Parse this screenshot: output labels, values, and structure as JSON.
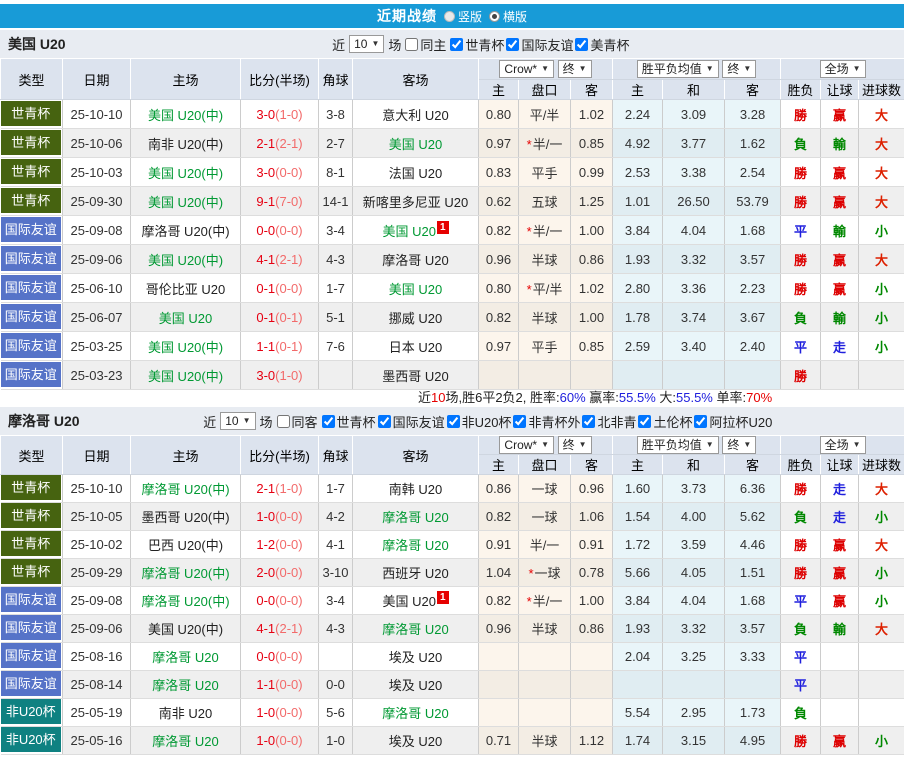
{
  "topbar": {
    "title": "近期战绩",
    "radio_vertical": "竖版",
    "radio_horizontal": "横版",
    "bg": "#189bd7"
  },
  "columns": {
    "type": "类型",
    "date": "日期",
    "home": "主场",
    "score": "比分(半场)",
    "corner": "角球",
    "away": "客场",
    "dd_company": "Crow*",
    "dd_final": "终",
    "dd_avg": "胜平负均值",
    "dd_final2": "终",
    "dd_scope": "全场",
    "sub_home": "主",
    "sub_handicap": "盘口",
    "sub_away": "客",
    "sub_home2": "主",
    "sub_draw": "和",
    "sub_away2": "客",
    "sub_result": "胜负",
    "sub_let": "让球",
    "sub_goals": "进球数"
  },
  "type_colors": {
    "世青杯": "#466310",
    "国际友谊": "#5673c8",
    "非U20杯": "#0f8181"
  },
  "result_color_map": {
    "勝": "#dd0000",
    "負": "#008800",
    "平": "#2020dd",
    "赢": "#dd0000",
    "輸": "#008800",
    "走": "#2020dd",
    "大": "#dd2000",
    "小": "#008800"
  },
  "tables": [
    {
      "team": "美国 U20",
      "filter": {
        "near_label": "近",
        "count": "10",
        "games_label": "场",
        "same_label": "同主",
        "same_checked": false,
        "leagues": [
          "世青杯",
          "国际友谊",
          "美青杯"
        ]
      },
      "rows": [
        {
          "type": "世青杯",
          "date": "25-10-10",
          "home": "美国 U20(中)",
          "home_green": true,
          "score": "3-0",
          "half": "(1-0)",
          "corner": "3-8",
          "away": "意大利 U20",
          "away_green": false,
          "badge": "",
          "odds_home": "0.80",
          "handicap": "平/半",
          "handicap_star": false,
          "odds_away": "1.02",
          "avg_home": "2.24",
          "avg_draw": "3.09",
          "avg_away": "3.28",
          "result": "勝",
          "handicap_result": "赢",
          "goals": "大"
        },
        {
          "type": "世青杯",
          "date": "25-10-06",
          "home": "南非 U20(中)",
          "home_green": false,
          "score": "2-1",
          "half": "(2-1)",
          "corner": "2-7",
          "away": "美国 U20",
          "away_green": true,
          "badge": "",
          "odds_home": "0.97",
          "handicap": "半/一",
          "handicap_star": true,
          "odds_away": "0.85",
          "avg_home": "4.92",
          "avg_draw": "3.77",
          "avg_away": "1.62",
          "result": "負",
          "handicap_result": "輸",
          "goals": "大"
        },
        {
          "type": "世青杯",
          "date": "25-10-03",
          "home": "美国 U20(中)",
          "home_green": true,
          "score": "3-0",
          "half": "(0-0)",
          "corner": "8-1",
          "away": "法国 U20",
          "away_green": false,
          "badge": "",
          "odds_home": "0.83",
          "handicap": "平手",
          "handicap_star": false,
          "odds_away": "0.99",
          "avg_home": "2.53",
          "avg_draw": "3.38",
          "avg_away": "2.54",
          "result": "勝",
          "handicap_result": "赢",
          "goals": "大"
        },
        {
          "type": "世青杯",
          "date": "25-09-30",
          "home": "美国 U20(中)",
          "home_green": true,
          "score": "9-1",
          "half": "(7-0)",
          "corner": "14-1",
          "away": "新喀里多尼亚 U20",
          "away_green": false,
          "badge": "",
          "odds_home": "0.62",
          "handicap": "五球",
          "handicap_star": false,
          "odds_away": "1.25",
          "avg_home": "1.01",
          "avg_draw": "26.50",
          "avg_away": "53.79",
          "result": "勝",
          "handicap_result": "赢",
          "goals": "大"
        },
        {
          "type": "国际友谊",
          "date": "25-09-08",
          "home": "摩洛哥 U20(中)",
          "home_green": false,
          "score": "0-0",
          "half": "(0-0)",
          "corner": "3-4",
          "away": "美国 U20",
          "away_green": true,
          "badge": "1",
          "odds_home": "0.82",
          "handicap": "半/一",
          "handicap_star": true,
          "odds_away": "1.00",
          "avg_home": "3.84",
          "avg_draw": "4.04",
          "avg_away": "1.68",
          "result": "平",
          "handicap_result": "輸",
          "goals": "小"
        },
        {
          "type": "国际友谊",
          "date": "25-09-06",
          "home": "美国 U20(中)",
          "home_green": true,
          "score": "4-1",
          "half": "(2-1)",
          "corner": "4-3",
          "away": "摩洛哥 U20",
          "away_green": false,
          "badge": "",
          "odds_home": "0.96",
          "handicap": "半球",
          "handicap_star": false,
          "odds_away": "0.86",
          "avg_home": "1.93",
          "avg_draw": "3.32",
          "avg_away": "3.57",
          "result": "勝",
          "handicap_result": "赢",
          "goals": "大"
        },
        {
          "type": "国际友谊",
          "date": "25-06-10",
          "home": "哥伦比亚 U20",
          "home_green": false,
          "score": "0-1",
          "half": "(0-0)",
          "corner": "1-7",
          "away": "美国 U20",
          "away_green": true,
          "badge": "",
          "odds_home": "0.80",
          "handicap": "平/半",
          "handicap_star": true,
          "odds_away": "1.02",
          "avg_home": "2.80",
          "avg_draw": "3.36",
          "avg_away": "2.23",
          "result": "勝",
          "handicap_result": "赢",
          "goals": "小"
        },
        {
          "type": "国际友谊",
          "date": "25-06-07",
          "home": "美国 U20",
          "home_green": true,
          "score": "0-1",
          "half": "(0-1)",
          "corner": "5-1",
          "away": "挪威 U20",
          "away_green": false,
          "badge": "",
          "odds_home": "0.82",
          "handicap": "半球",
          "handicap_star": false,
          "odds_away": "1.00",
          "avg_home": "1.78",
          "avg_draw": "3.74",
          "avg_away": "3.67",
          "result": "負",
          "handicap_result": "輸",
          "goals": "小"
        },
        {
          "type": "国际友谊",
          "date": "25-03-25",
          "home": "美国 U20(中)",
          "home_green": true,
          "score": "1-1",
          "half": "(0-1)",
          "corner": "7-6",
          "away": "日本 U20",
          "away_green": false,
          "badge": "",
          "odds_home": "0.97",
          "handicap": "平手",
          "handicap_star": false,
          "odds_away": "0.85",
          "avg_home": "2.59",
          "avg_draw": "3.40",
          "avg_away": "2.40",
          "result": "平",
          "handicap_result": "走",
          "goals": "小"
        },
        {
          "type": "国际友谊",
          "date": "25-03-23",
          "home": "美国 U20(中)",
          "home_green": true,
          "score": "3-0",
          "half": "(1-0)",
          "corner": "",
          "away": "墨西哥 U20",
          "away_green": false,
          "badge": "",
          "odds_home": "",
          "handicap": "",
          "handicap_star": false,
          "odds_away": "",
          "avg_home": "",
          "avg_draw": "",
          "avg_away": "",
          "result": "勝",
          "handicap_result": "",
          "goals": ""
        }
      ],
      "footer": [
        {
          "t": "近",
          "c": ""
        },
        {
          "t": "10",
          "c": "#e60000"
        },
        {
          "t": "场,胜6平2负2, 胜率:",
          "c": ""
        },
        {
          "t": "60%",
          "c": "#2020dd"
        },
        {
          "t": " 赢率:",
          "c": ""
        },
        {
          "t": "55.5%",
          "c": "#2020dd"
        },
        {
          "t": " 大:",
          "c": ""
        },
        {
          "t": "55.5%",
          "c": "#2020dd"
        },
        {
          "t": " 单率:",
          "c": ""
        },
        {
          "t": "70%",
          "c": "#e60000"
        }
      ]
    },
    {
      "team": "摩洛哥 U20",
      "filter": {
        "near_label": "近",
        "count": "10",
        "games_label": "场",
        "same_label": "同客",
        "same_checked": false,
        "leagues": [
          "世青杯",
          "国际友谊",
          "非U20杯",
          "非青杯外",
          "北非青",
          "土伦杯",
          "阿拉杯U20"
        ]
      },
      "rows": [
        {
          "type": "世青杯",
          "date": "25-10-10",
          "home": "摩洛哥 U20(中)",
          "home_green": true,
          "score": "2-1",
          "half": "(1-0)",
          "corner": "1-7",
          "away": "南韩 U20",
          "away_green": false,
          "badge": "",
          "odds_home": "0.86",
          "handicap": "一球",
          "handicap_star": false,
          "odds_away": "0.96",
          "avg_home": "1.60",
          "avg_draw": "3.73",
          "avg_away": "6.36",
          "result": "勝",
          "handicap_result": "走",
          "goals": "大"
        },
        {
          "type": "世青杯",
          "date": "25-10-05",
          "home": "墨西哥 U20(中)",
          "home_green": false,
          "score": "1-0",
          "half": "(0-0)",
          "corner": "4-2",
          "away": "摩洛哥 U20",
          "away_green": true,
          "badge": "",
          "odds_home": "0.82",
          "handicap": "一球",
          "handicap_star": false,
          "odds_away": "1.06",
          "avg_home": "1.54",
          "avg_draw": "4.00",
          "avg_away": "5.62",
          "result": "負",
          "handicap_result": "走",
          "goals": "小"
        },
        {
          "type": "世青杯",
          "date": "25-10-02",
          "home": "巴西 U20(中)",
          "home_green": false,
          "score": "1-2",
          "half": "(0-0)",
          "corner": "4-1",
          "away": "摩洛哥 U20",
          "away_green": true,
          "badge": "",
          "odds_home": "0.91",
          "handicap": "半/一",
          "handicap_star": false,
          "odds_away": "0.91",
          "avg_home": "1.72",
          "avg_draw": "3.59",
          "avg_away": "4.46",
          "result": "勝",
          "handicap_result": "赢",
          "goals": "大"
        },
        {
          "type": "世青杯",
          "date": "25-09-29",
          "home": "摩洛哥 U20(中)",
          "home_green": true,
          "score": "2-0",
          "half": "(0-0)",
          "corner": "3-10",
          "away": "西班牙 U20",
          "away_green": false,
          "badge": "",
          "odds_home": "1.04",
          "handicap": "一球",
          "handicap_star": true,
          "odds_away": "0.78",
          "avg_home": "5.66",
          "avg_draw": "4.05",
          "avg_away": "1.51",
          "result": "勝",
          "handicap_result": "赢",
          "goals": "小"
        },
        {
          "type": "国际友谊",
          "date": "25-09-08",
          "home": "摩洛哥 U20(中)",
          "home_green": true,
          "score": "0-0",
          "half": "(0-0)",
          "corner": "3-4",
          "away": "美国 U20",
          "away_green": false,
          "badge": "1",
          "odds_home": "0.82",
          "handicap": "半/一",
          "handicap_star": true,
          "odds_away": "1.00",
          "avg_home": "3.84",
          "avg_draw": "4.04",
          "avg_away": "1.68",
          "result": "平",
          "handicap_result": "赢",
          "goals": "小"
        },
        {
          "type": "国际友谊",
          "date": "25-09-06",
          "home": "美国 U20(中)",
          "home_green": false,
          "score": "4-1",
          "half": "(2-1)",
          "corner": "4-3",
          "away": "摩洛哥 U20",
          "away_green": true,
          "badge": "",
          "odds_home": "0.96",
          "handicap": "半球",
          "handicap_star": false,
          "odds_away": "0.86",
          "avg_home": "1.93",
          "avg_draw": "3.32",
          "avg_away": "3.57",
          "result": "負",
          "handicap_result": "輸",
          "goals": "大"
        },
        {
          "type": "国际友谊",
          "date": "25-08-16",
          "home": "摩洛哥 U20",
          "home_green": true,
          "score": "0-0",
          "half": "(0-0)",
          "corner": "",
          "away": "埃及 U20",
          "away_green": false,
          "badge": "",
          "odds_home": "",
          "handicap": "",
          "handicap_star": false,
          "odds_away": "",
          "avg_home": "2.04",
          "avg_draw": "3.25",
          "avg_away": "3.33",
          "result": "平",
          "handicap_result": "",
          "goals": ""
        },
        {
          "type": "国际友谊",
          "date": "25-08-14",
          "home": "摩洛哥 U20",
          "home_green": true,
          "score": "1-1",
          "half": "(0-0)",
          "corner": "0-0",
          "away": "埃及 U20",
          "away_green": false,
          "badge": "",
          "odds_home": "",
          "handicap": "",
          "handicap_star": false,
          "odds_away": "",
          "avg_home": "",
          "avg_draw": "",
          "avg_away": "",
          "result": "平",
          "handicap_result": "",
          "goals": ""
        },
        {
          "type": "非U20杯",
          "date": "25-05-19",
          "home": "南非 U20",
          "home_green": false,
          "score": "1-0",
          "half": "(0-0)",
          "corner": "5-6",
          "away": "摩洛哥 U20",
          "away_green": true,
          "badge": "",
          "odds_home": "",
          "handicap": "",
          "handicap_star": false,
          "odds_away": "",
          "avg_home": "5.54",
          "avg_draw": "2.95",
          "avg_away": "1.73",
          "result": "負",
          "handicap_result": "",
          "goals": ""
        },
        {
          "type": "非U20杯",
          "date": "25-05-16",
          "home": "摩洛哥 U20",
          "home_green": true,
          "score": "1-0",
          "half": "(0-0)",
          "corner": "1-0",
          "away": "埃及 U20",
          "away_green": false,
          "badge": "",
          "odds_home": "0.71",
          "handicap": "半球",
          "handicap_star": false,
          "odds_away": "1.12",
          "avg_home": "1.74",
          "avg_draw": "3.15",
          "avg_away": "4.95",
          "result": "勝",
          "handicap_result": "赢",
          "goals": "小"
        }
      ]
    }
  ]
}
